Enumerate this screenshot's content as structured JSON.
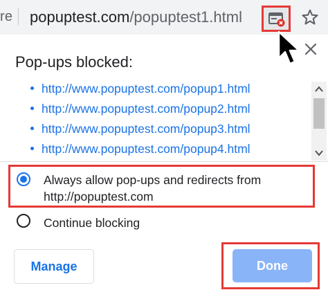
{
  "omnibox": {
    "left_fragment": "re",
    "url_domain": "popuptest.com",
    "url_path": "/popuptest1.html"
  },
  "icons": {
    "popup_blocked": "popup-blocked-icon",
    "bookmark": "star-icon",
    "close": "close-icon",
    "cursor": "mouse-cursor-icon"
  },
  "bubble": {
    "title": "Pop-ups blocked:",
    "blocked_links": [
      "http://www.popuptest.com/popup1.html",
      "http://www.popuptest.com/popup2.html",
      "http://www.popuptest.com/popup3.html",
      "http://www.popuptest.com/popup4.html"
    ],
    "options": [
      {
        "label": "Always allow pop-ups and redirects from http://popuptest.com",
        "selected": true
      },
      {
        "label": "Continue blocking",
        "selected": false
      }
    ],
    "manage_label": "Manage",
    "done_label": "Done"
  },
  "colors": {
    "accent": "#1a73e8",
    "highlight_border": "#e53935",
    "done_disabled": "#8ab4f8"
  }
}
